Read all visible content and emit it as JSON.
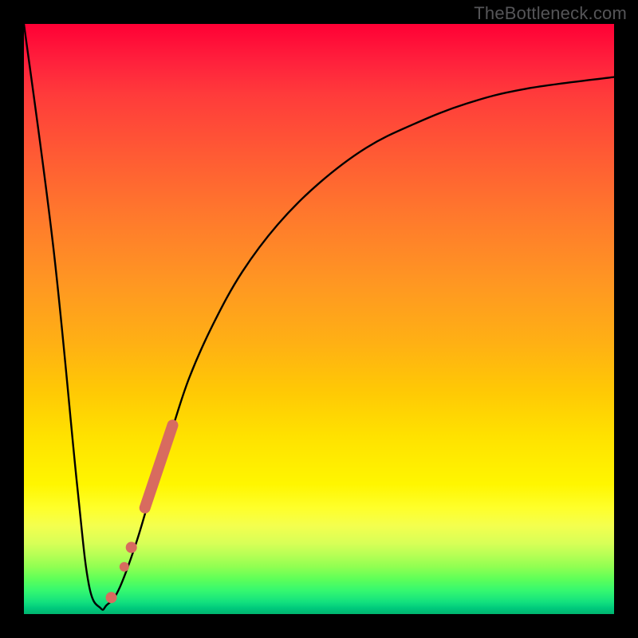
{
  "watermark": "TheBottleneck.com",
  "chart_data": {
    "type": "line",
    "title": "",
    "xlabel": "",
    "ylabel": "",
    "xlim": [
      0,
      100
    ],
    "ylim": [
      0,
      100
    ],
    "grid": false,
    "legend": false,
    "series": [
      {
        "name": "bottleneck-curve",
        "x": [
          0,
          5,
          9,
          11,
          13,
          14,
          16,
          19,
          22,
          25,
          28,
          32,
          37,
          43,
          50,
          58,
          66,
          75,
          85,
          100
        ],
        "y": [
          100,
          62,
          22,
          5,
          1,
          1.5,
          4,
          12,
          22,
          31,
          40,
          49,
          58,
          66,
          73,
          79,
          83,
          86.5,
          89,
          91
        ]
      }
    ],
    "markers": [
      {
        "name": "highlight-segment",
        "shape": "thick-line",
        "color": "#d86b5f",
        "x": [
          20.5,
          25.2
        ],
        "y": [
          18,
          32
        ]
      },
      {
        "name": "highlight-dot-1",
        "shape": "circle",
        "color": "#d86b5f",
        "x": 18.2,
        "y": 11.3
      },
      {
        "name": "highlight-dot-2",
        "shape": "circle",
        "color": "#d86b5f",
        "x": 17.0,
        "y": 8.0
      },
      {
        "name": "highlight-dot-3",
        "shape": "circle",
        "color": "#d86b5f",
        "x": 14.8,
        "y": 2.8
      }
    ],
    "background_gradient": {
      "direction": "vertical",
      "stops": [
        {
          "pos": 0.0,
          "color": "#ff0035"
        },
        {
          "pos": 0.3,
          "color": "#ff6a2f"
        },
        {
          "pos": 0.6,
          "color": "#ffc600"
        },
        {
          "pos": 0.8,
          "color": "#fcff20"
        },
        {
          "pos": 0.9,
          "color": "#a8ff55"
        },
        {
          "pos": 1.0,
          "color": "#00b56f"
        }
      ]
    }
  }
}
